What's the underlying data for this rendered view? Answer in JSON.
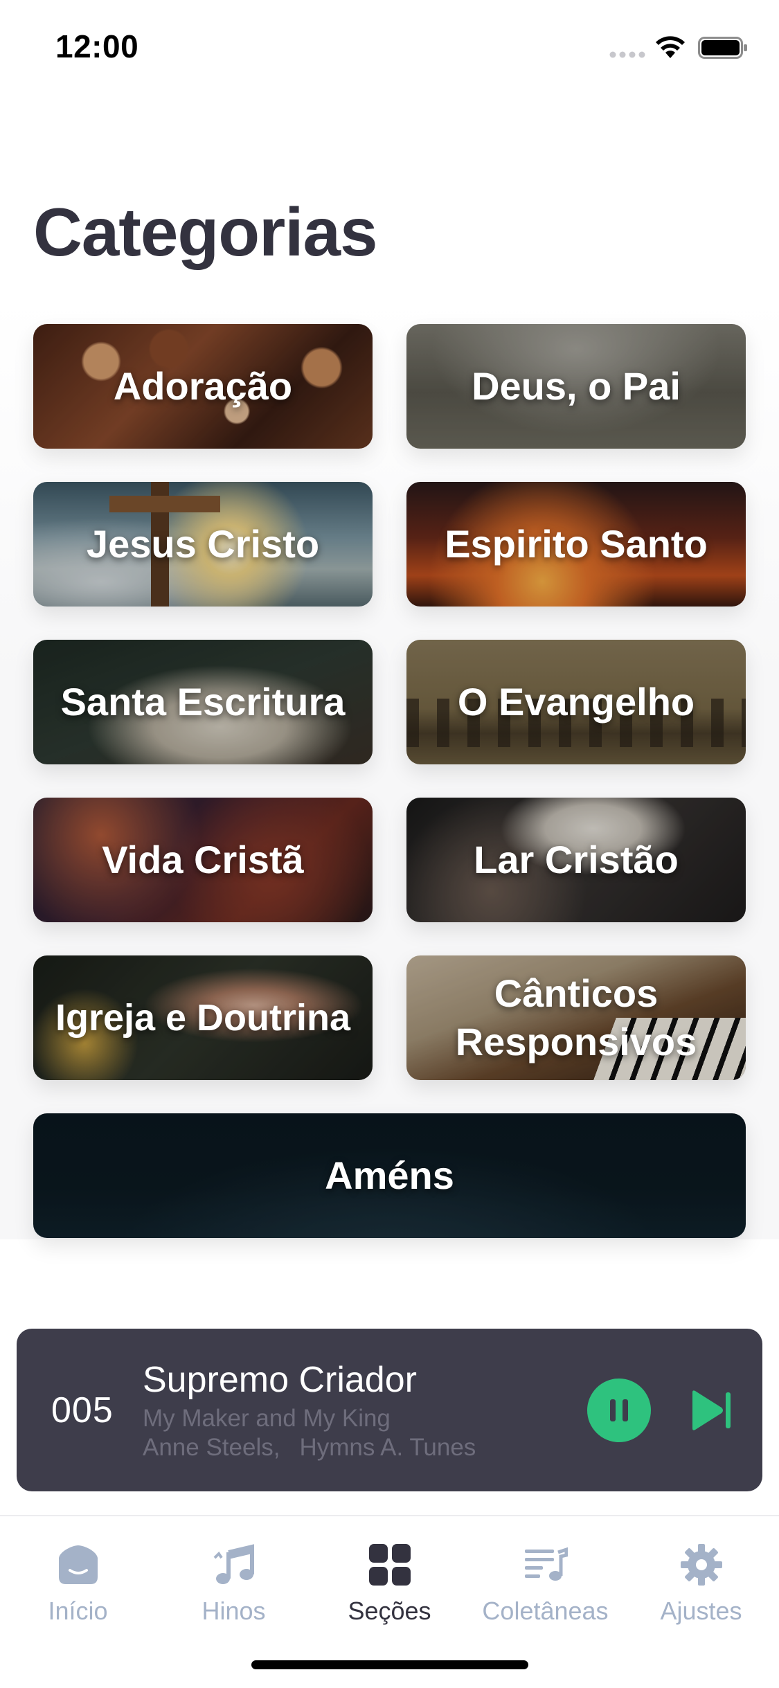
{
  "status_bar": {
    "time": "12:00"
  },
  "page": {
    "title": "Categorias"
  },
  "categories": [
    {
      "label": "Adoração"
    },
    {
      "label": "Deus, o Pai"
    },
    {
      "label": "Jesus Cristo"
    },
    {
      "label": "Espirito Santo"
    },
    {
      "label": "Santa Escritura"
    },
    {
      "label": "O Evangelho"
    },
    {
      "label": "Vida Cristã"
    },
    {
      "label": "Lar Cristão"
    },
    {
      "label": "Igreja e Doutrina"
    },
    {
      "label": "Cânticos Responsivos"
    },
    {
      "label": "Améns"
    }
  ],
  "player": {
    "number": "005",
    "title": "Supremo Criador",
    "subtitle": "My Maker and My King",
    "author": "Anne Steels,",
    "source": "Hymns A. Tunes",
    "accent_color": "#2ec27e",
    "state": "playing"
  },
  "tab_bar": {
    "active": "Seções",
    "tabs": [
      {
        "label": "Início",
        "icon": "home-icon"
      },
      {
        "label": "Hinos",
        "icon": "music-note-icon"
      },
      {
        "label": "Seções",
        "icon": "grid-icon"
      },
      {
        "label": "Coletâneas",
        "icon": "playlist-icon"
      },
      {
        "label": "Ajustes",
        "icon": "gear-icon"
      }
    ]
  }
}
